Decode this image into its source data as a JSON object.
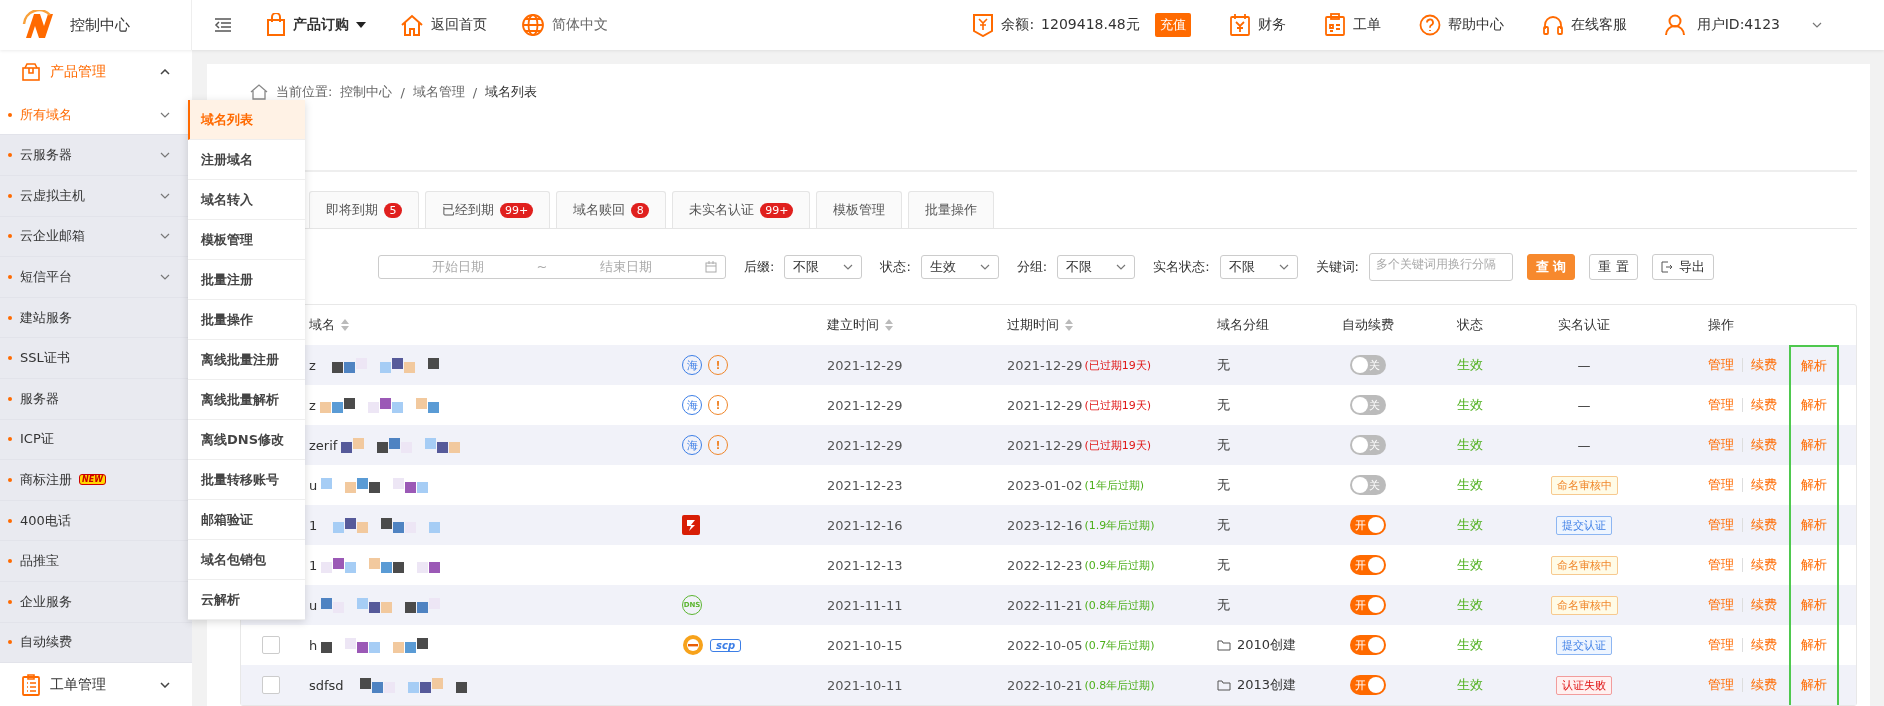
{
  "topbar": {
    "title": "控制中心",
    "order": "产品订购",
    "home": "返回首页",
    "language": "简体中文",
    "balance_label": "余额:",
    "balance": "1209418.48元",
    "recharge": "充值",
    "links": [
      {
        "kind": "finance",
        "label": "财务"
      },
      {
        "kind": "ticket",
        "label": "工单"
      },
      {
        "kind": "help",
        "label": "帮助中心"
      },
      {
        "kind": "service",
        "label": "在线客服"
      }
    ],
    "user": "用户ID:4123"
  },
  "sidebar": {
    "group": {
      "label": "产品管理",
      "expanded": true
    },
    "items": [
      {
        "label": "所有域名",
        "selected": true,
        "has_children": true
      },
      {
        "label": "云服务器",
        "selected": false,
        "has_children": true
      },
      {
        "label": "云虚拟主机",
        "selected": false,
        "has_children": true
      },
      {
        "label": "云企业邮箱",
        "selected": false,
        "has_children": true
      },
      {
        "label": "短信平台",
        "selected": false,
        "has_children": true
      },
      {
        "label": "建站服务",
        "selected": false,
        "has_children": false
      },
      {
        "label": "SSL证书",
        "selected": false,
        "has_children": false
      },
      {
        "label": "服务器",
        "selected": false,
        "has_children": false
      },
      {
        "label": "ICP证",
        "selected": false,
        "has_children": false
      },
      {
        "label": "商标注册",
        "selected": false,
        "has_children": false,
        "badge": "NEW"
      },
      {
        "label": "400电话",
        "selected": false,
        "has_children": false
      },
      {
        "label": "品推宝",
        "selected": false,
        "has_children": false
      },
      {
        "label": "企业服务",
        "selected": false,
        "has_children": false
      },
      {
        "label": "自动续费",
        "selected": false,
        "has_children": false
      }
    ],
    "bottom_group": {
      "label": "工单管理",
      "expanded": false
    }
  },
  "flyout_menu": [
    {
      "label": "域名列表",
      "selected": true
    },
    {
      "label": "注册域名",
      "selected": false
    },
    {
      "label": "域名转入",
      "selected": false
    },
    {
      "label": "模板管理",
      "selected": false
    },
    {
      "label": "批量注册",
      "selected": false
    },
    {
      "label": "批量操作",
      "selected": false
    },
    {
      "label": "离线批量注册",
      "selected": false
    },
    {
      "label": "离线批量解析",
      "selected": false
    },
    {
      "label": "离线DNS修改",
      "selected": false
    },
    {
      "label": "批量转移账号",
      "selected": false
    },
    {
      "label": "邮箱验证",
      "selected": false
    },
    {
      "label": "域名包销包",
      "selected": false
    },
    {
      "label": "云解析",
      "selected": false
    }
  ],
  "breadcrumb": {
    "label": "当前位置:",
    "separator": "/",
    "items": [
      "控制中心",
      "域名管理",
      "域名列表"
    ]
  },
  "tabs": [
    {
      "label": "即将到期",
      "count": "5",
      "selected": false
    },
    {
      "label": "已经到期",
      "count": "99+",
      "selected": false
    },
    {
      "label": "域名赎回",
      "count": "8",
      "selected": false
    },
    {
      "label": "未实名认证",
      "count": "99+",
      "selected": false
    },
    {
      "label": "模板管理",
      "selected": false
    },
    {
      "label": "批量操作",
      "selected": false
    }
  ],
  "filters": {
    "date_start": "开始日期",
    "date_sep": "~",
    "date_end": "结束日期",
    "selects": [
      {
        "label": "后缀:",
        "value": "不限"
      },
      {
        "label": "状态:",
        "value": "生效"
      },
      {
        "label": "分组:",
        "value": "不限"
      },
      {
        "label": "实名状态:",
        "value": "不限"
      }
    ],
    "keyword_label": "关键词:",
    "keyword_placeholder": "多个关键词用换行分隔",
    "buttons": [
      {
        "kind": "primary",
        "label": "查 询"
      },
      {
        "kind": "plain",
        "label": "重 置"
      },
      {
        "kind": "export",
        "label": "导出"
      }
    ]
  },
  "table": {
    "columns": [
      {
        "label": "域名",
        "sortable": true
      },
      {
        "label": "建立时间",
        "sortable": true
      },
      {
        "label": "过期时间",
        "sortable": true
      },
      {
        "label": "域名分组",
        "sortable": false
      },
      {
        "label": "自动续费",
        "sortable": false
      },
      {
        "label": "状态",
        "sortable": false
      },
      {
        "label": "实名认证",
        "sortable": false
      },
      {
        "label": "操作",
        "sortable": false
      }
    ],
    "rows": [
      {
        "domain": "z",
        "icons": [
          {
            "kind": "circle-blue",
            "text": "海"
          },
          {
            "kind": "circle-orange",
            "text": "!"
          }
        ],
        "created": "2021-12-29",
        "expires": "2021-12-29",
        "expires_note": "(已过期19天)",
        "expired": true,
        "group": {
          "text": "无",
          "folder": false
        },
        "auto_renew": {
          "on": false,
          "label": "关"
        },
        "status": "生效",
        "realname": {
          "kind": "dash",
          "text": "—"
        },
        "actions": [
          {
            "label": "管理",
            "highlighted": false
          },
          {
            "label": "续费",
            "highlighted": false
          },
          {
            "label": "解析",
            "highlighted": true
          }
        ]
      },
      {
        "domain": "z",
        "icons": [
          {
            "kind": "circle-blue",
            "text": "海"
          },
          {
            "kind": "circle-orange",
            "text": "!"
          }
        ],
        "created": "2021-12-29",
        "expires": "2021-12-29",
        "expires_note": "(已过期19天)",
        "expired": true,
        "group": {
          "text": "无",
          "folder": false
        },
        "auto_renew": {
          "on": false,
          "label": "关"
        },
        "status": "生效",
        "realname": {
          "kind": "dash",
          "text": "—"
        },
        "actions": [
          {
            "label": "管理",
            "highlighted": false
          },
          {
            "label": "续费",
            "highlighted": false
          },
          {
            "label": "解析",
            "highlighted": true
          }
        ]
      },
      {
        "domain": "zerif",
        "icons": [
          {
            "kind": "circle-blue",
            "text": "海"
          },
          {
            "kind": "circle-orange",
            "text": "!"
          }
        ],
        "created": "2021-12-29",
        "expires": "2021-12-29",
        "expires_note": "(已过期19天)",
        "expired": true,
        "group": {
          "text": "无",
          "folder": false
        },
        "auto_renew": {
          "on": false,
          "label": "关"
        },
        "status": "生效",
        "realname": {
          "kind": "dash",
          "text": "—"
        },
        "actions": [
          {
            "label": "管理",
            "highlighted": false
          },
          {
            "label": "续费",
            "highlighted": false
          },
          {
            "label": "解析",
            "highlighted": true
          }
        ]
      },
      {
        "domain": "u",
        "icons": [],
        "created": "2021-12-23",
        "expires": "2023-01-02",
        "expires_note": "(1年后过期)",
        "expired": false,
        "group": {
          "text": "无",
          "folder": false
        },
        "auto_renew": {
          "on": false,
          "label": "关"
        },
        "status": "生效",
        "realname": {
          "kind": "pending",
          "text": "命名审核中"
        },
        "actions": [
          {
            "label": "管理",
            "highlighted": false
          },
          {
            "label": "续费",
            "highlighted": false
          },
          {
            "label": "解析",
            "highlighted": true
          }
        ]
      },
      {
        "domain": "1",
        "icons": [
          {
            "kind": "red-e"
          }
        ],
        "created": "2021-12-16",
        "expires": "2023-12-16",
        "expires_note": "(1.9年后过期)",
        "expired": false,
        "group": {
          "text": "无",
          "folder": false
        },
        "auto_renew": {
          "on": true,
          "label": "开"
        },
        "status": "生效",
        "realname": {
          "kind": "submit",
          "text": "提交认证"
        },
        "actions": [
          {
            "label": "管理",
            "highlighted": false
          },
          {
            "label": "续费",
            "highlighted": false
          },
          {
            "label": "解析",
            "highlighted": true
          }
        ]
      },
      {
        "domain": "1",
        "icons": [],
        "created": "2021-12-13",
        "expires": "2022-12-23",
        "expires_note": "(0.9年后过期)",
        "expired": false,
        "group": {
          "text": "无",
          "folder": false
        },
        "auto_renew": {
          "on": true,
          "label": "开"
        },
        "status": "生效",
        "realname": {
          "kind": "pending",
          "text": "命名审核中"
        },
        "actions": [
          {
            "label": "管理",
            "highlighted": false
          },
          {
            "label": "续费",
            "highlighted": false
          },
          {
            "label": "解析",
            "highlighted": true
          }
        ]
      },
      {
        "domain": "u",
        "icons": [
          {
            "kind": "dns",
            "text": "DNS"
          }
        ],
        "created": "2021-11-11",
        "expires": "2022-11-21",
        "expires_note": "(0.8年后过期)",
        "expired": false,
        "group": {
          "text": "无",
          "folder": false
        },
        "auto_renew": {
          "on": true,
          "label": "开"
        },
        "status": "生效",
        "realname": {
          "kind": "pending",
          "text": "命名审核中"
        },
        "actions": [
          {
            "label": "管理",
            "highlighted": false
          },
          {
            "label": "续费",
            "highlighted": false
          },
          {
            "label": "解析",
            "highlighted": true
          }
        ]
      },
      {
        "domain": "h",
        "checked": false,
        "icons": [
          {
            "kind": "orange-coin"
          },
          {
            "kind": "scp",
            "text": "scp"
          }
        ],
        "created": "2021-10-15",
        "expires": "2022-10-05",
        "expires_note": "(0.7年后过期)",
        "expired": false,
        "group": {
          "text": "2010创建",
          "folder": true
        },
        "auto_renew": {
          "on": true,
          "label": "开"
        },
        "status": "生效",
        "realname": {
          "kind": "submit",
          "text": "提交认证"
        },
        "actions": [
          {
            "label": "管理",
            "highlighted": false
          },
          {
            "label": "续费",
            "highlighted": false
          },
          {
            "label": "解析",
            "highlighted": true
          }
        ]
      },
      {
        "domain": "sdfsd",
        "checked": false,
        "icons": [],
        "created": "2021-10-11",
        "expires": "2022-10-21",
        "expires_note": "(0.8年后过期)",
        "expired": false,
        "group": {
          "text": "2013创建",
          "folder": true
        },
        "auto_renew": {
          "on": true,
          "label": "开"
        },
        "status": "生效",
        "realname": {
          "kind": "failed",
          "text": "认证失败"
        },
        "actions": [
          {
            "label": "管理",
            "highlighted": false
          },
          {
            "label": "续费",
            "highlighted": false
          },
          {
            "label": "解析",
            "highlighted": true
          }
        ]
      }
    ]
  }
}
